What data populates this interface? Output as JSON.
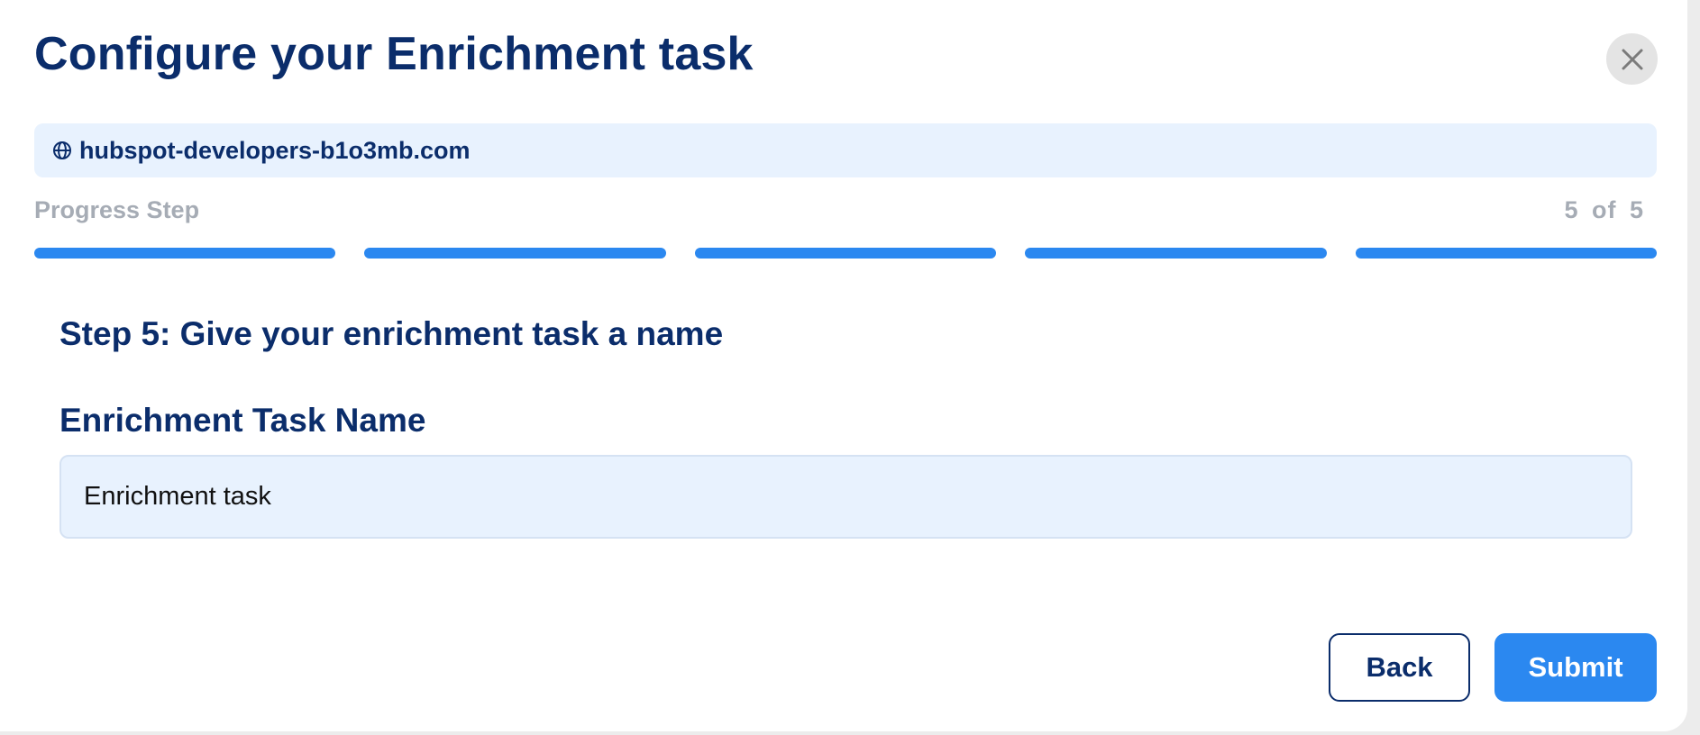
{
  "modal": {
    "title": "Configure your Enrichment task",
    "close_icon": "close-icon"
  },
  "domain_bar": {
    "icon": "globe-icon",
    "domain": "hubspot-developers-b1o3mb.com"
  },
  "progress": {
    "label": "Progress Step",
    "count_text": "5 of 5",
    "current_step": 5,
    "total_steps": 5
  },
  "step": {
    "title": "Step 5: Give your enrichment task a name"
  },
  "task_name_field": {
    "label": "Enrichment Task Name",
    "value": "Enrichment task",
    "placeholder": ""
  },
  "actions": {
    "back_label": "Back",
    "submit_label": "Submit"
  },
  "colors": {
    "primary_text": "#0b2d6b",
    "accent": "#2b88f0",
    "muted_text": "#a6acb5",
    "field_background": "#e8f2fe"
  }
}
